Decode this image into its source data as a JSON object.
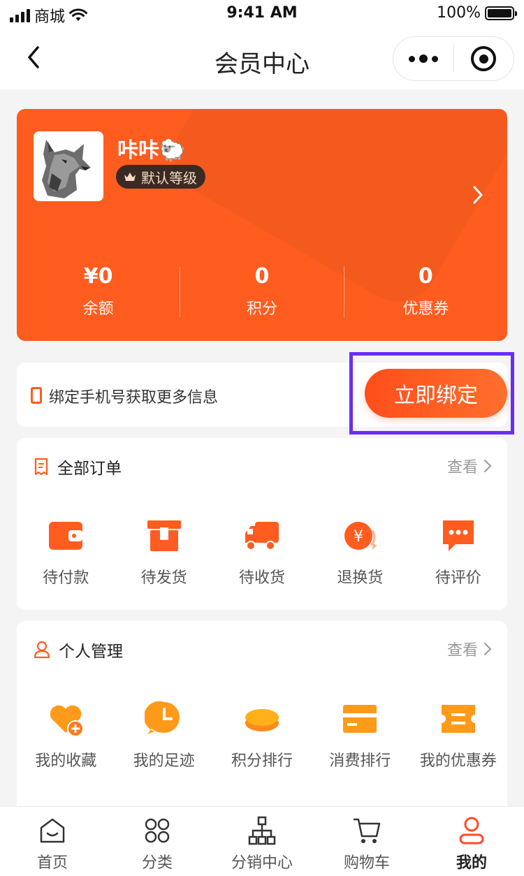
{
  "status_bar": {
    "carrier": "商城",
    "time": "9:41 AM",
    "battery": "100%"
  },
  "nav": {
    "title": "会员中心"
  },
  "member": {
    "name": "咔咔🐑",
    "level": "默认等级",
    "stats": [
      {
        "value": "¥0",
        "label": "余额"
      },
      {
        "value": "0",
        "label": "积分"
      },
      {
        "value": "0",
        "label": "优惠券"
      }
    ]
  },
  "bind_phone": {
    "text": "绑定手机号获取更多信息",
    "button": "立即绑定"
  },
  "orders": {
    "title": "全部订单",
    "more": "查看",
    "items": [
      {
        "label": "待付款",
        "icon": "wallet-icon"
      },
      {
        "label": "待发货",
        "icon": "box-icon"
      },
      {
        "label": "待收货",
        "icon": "truck-icon"
      },
      {
        "label": "退换货",
        "icon": "refund-icon"
      },
      {
        "label": "待评价",
        "icon": "comment-icon"
      }
    ]
  },
  "personal": {
    "title": "个人管理",
    "more": "查看",
    "items": [
      {
        "label": "我的收藏",
        "icon": "heart-add-icon"
      },
      {
        "label": "我的足迹",
        "icon": "clock-icon"
      },
      {
        "label": "积分排行",
        "icon": "coin-icon"
      },
      {
        "label": "消费排行",
        "icon": "card-icon"
      },
      {
        "label": "我的优惠券",
        "icon": "ticket-icon"
      }
    ]
  },
  "tabbar": [
    {
      "label": "首页",
      "icon": "home-icon"
    },
    {
      "label": "分类",
      "icon": "category-icon"
    },
    {
      "label": "分销中心",
      "icon": "network-icon"
    },
    {
      "label": "购物车",
      "icon": "cart-icon"
    },
    {
      "label": "我的",
      "icon": "user-icon",
      "active": true
    }
  ],
  "colors": {
    "accent": "#ff5c1f",
    "highlight": "#6a2ef2",
    "background": "#f4f4f4"
  }
}
